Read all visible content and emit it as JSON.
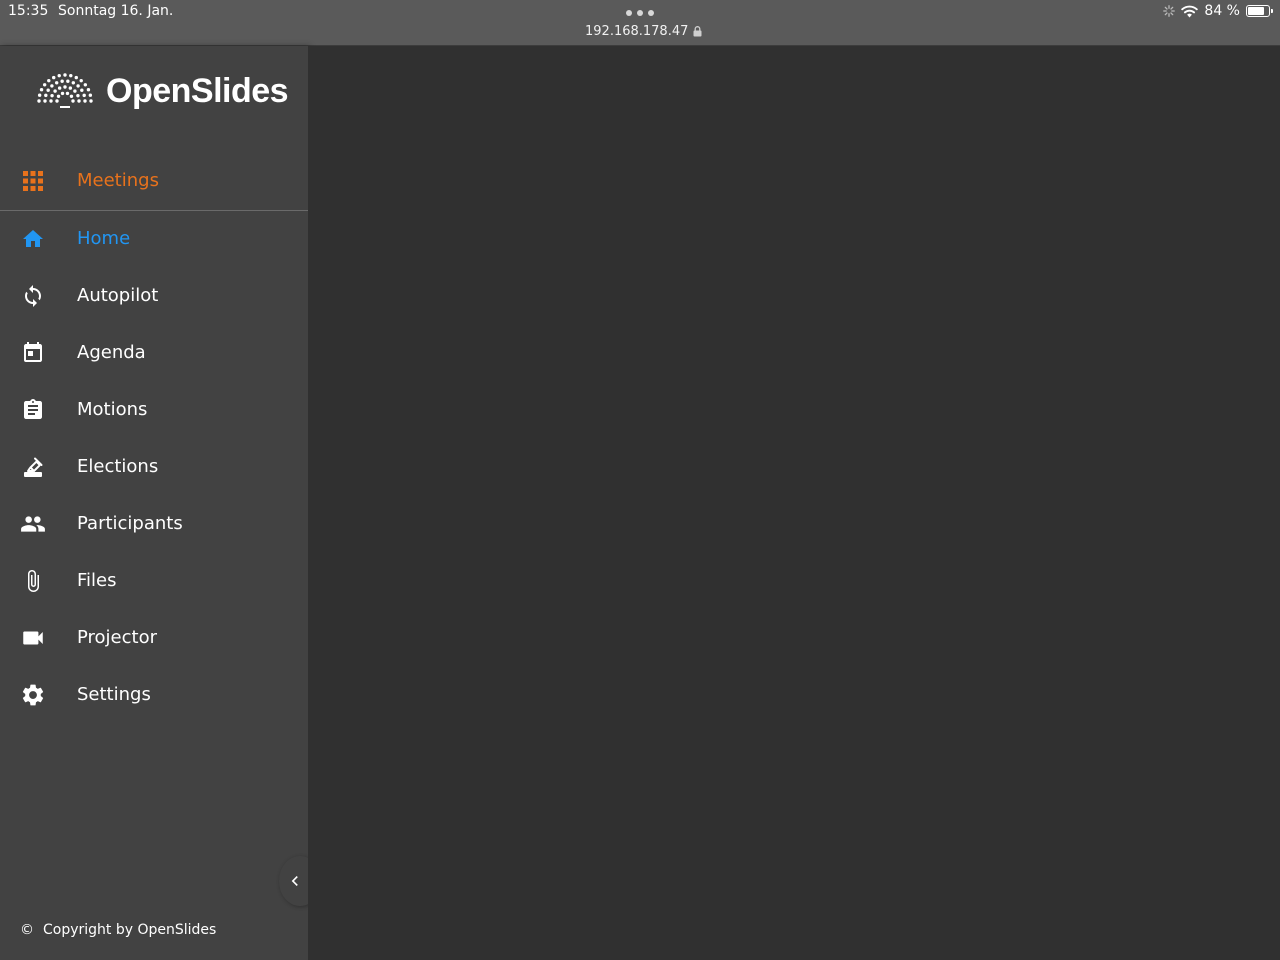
{
  "status_bar": {
    "time": "15:35",
    "date": "Sonntag 16. Jan.",
    "url": "192.168.178.47",
    "battery": "84 %",
    "battery_level": 0.84
  },
  "app": {
    "name": "OpenSlides",
    "brand_orange": "#e8721c",
    "active_blue": "#2196f3"
  },
  "nav": {
    "meetings": {
      "label": "Meetings",
      "icon": "grid-icon"
    },
    "items": [
      {
        "label": "Home",
        "icon": "home-icon",
        "active": true
      },
      {
        "label": "Autopilot",
        "icon": "sync-icon"
      },
      {
        "label": "Agenda",
        "icon": "calendar-icon"
      },
      {
        "label": "Motions",
        "icon": "clipboard-icon"
      },
      {
        "label": "Elections",
        "icon": "ballot-icon"
      },
      {
        "label": "Participants",
        "icon": "people-icon"
      },
      {
        "label": "Files",
        "icon": "paperclip-icon"
      },
      {
        "label": "Projector",
        "icon": "videocam-icon"
      },
      {
        "label": "Settings",
        "icon": "gear-icon"
      }
    ]
  },
  "footer": {
    "copyright_symbol": "©",
    "copyright": "Copyright by OpenSlides"
  }
}
